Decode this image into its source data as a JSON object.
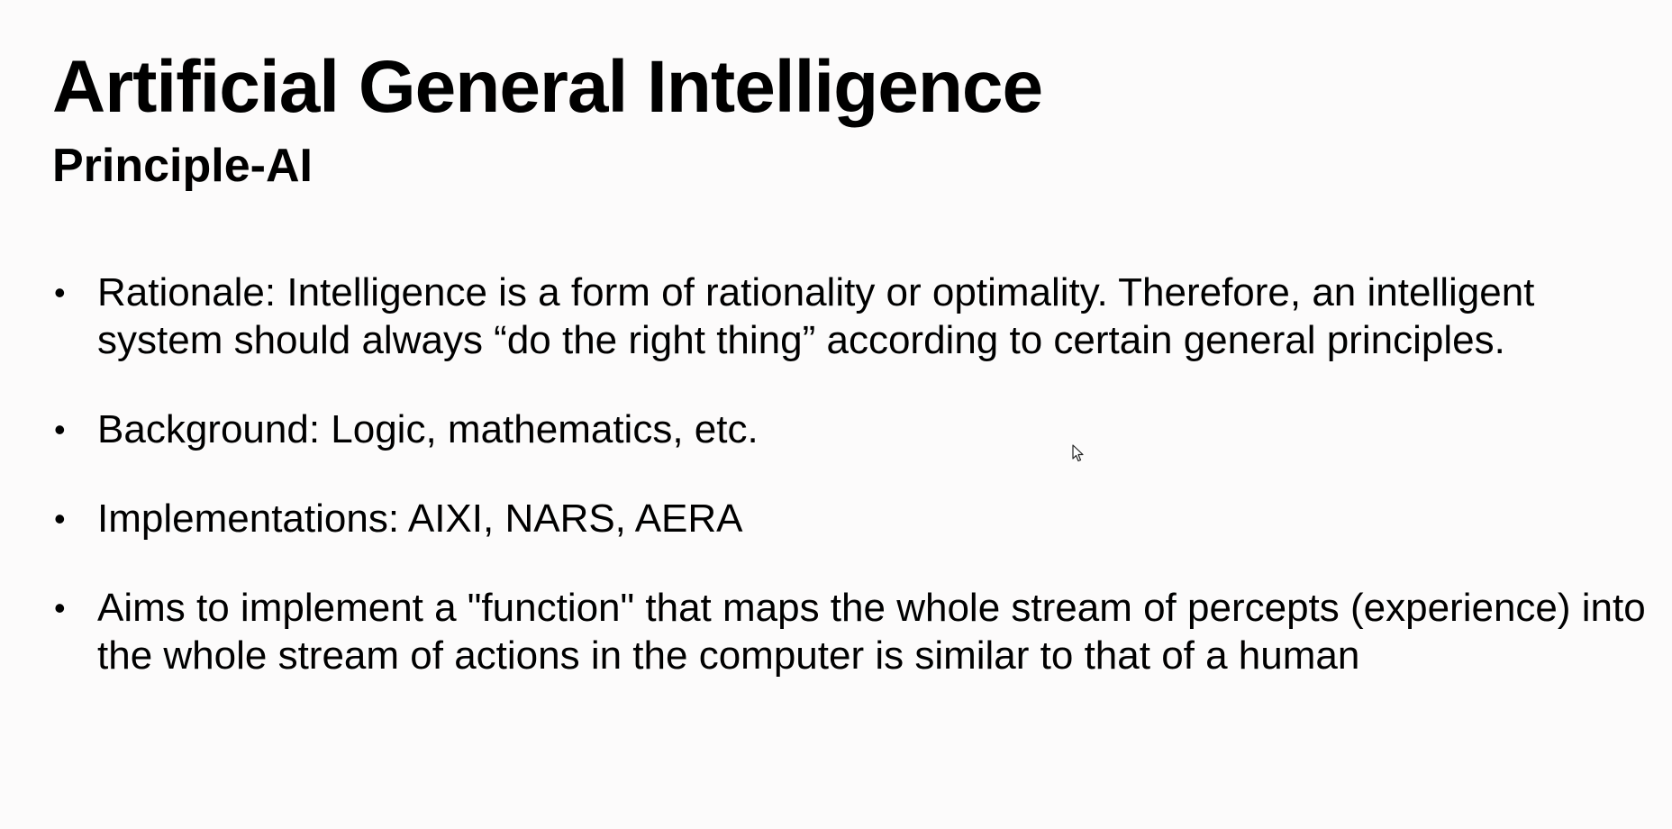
{
  "slide": {
    "title": "Artificial General Intelligence",
    "subtitle": "Principle-AI",
    "bullets": [
      {
        "text": "Rationale: Intelligence is a form of rationality or optimality. Therefore, an intelligent system should always “do the right thing” according to certain general principles."
      },
      {
        "text": "Background: Logic, mathematics, etc."
      },
      {
        "text": "Implementations: AIXI, NARS, AERA"
      },
      {
        "text": "Aims to implement a \"function\" that maps the whole stream of percepts (experience) into the whole stream of actions in the computer is similar to that of a human"
      }
    ],
    "bullet_glyph": "•"
  },
  "cursor": {
    "icon": "mouse-pointer-icon"
  }
}
